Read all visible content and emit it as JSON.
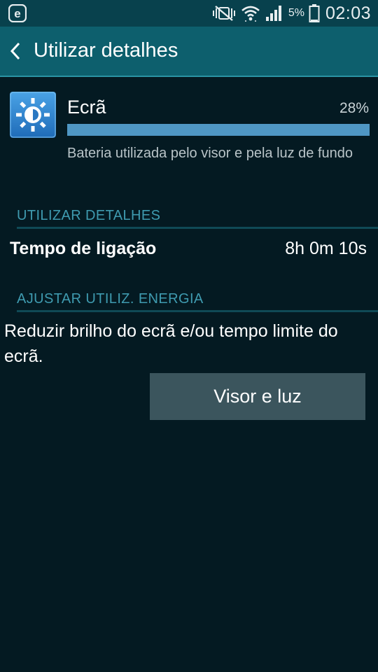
{
  "status_bar": {
    "app_icon": "e-browser-icon",
    "icons": [
      "mute-vibrate-icon",
      "wifi-icon",
      "signal-icon"
    ],
    "battery_percent": "5%",
    "battery_icon": "battery-icon",
    "time": "02:03"
  },
  "action_bar": {
    "back_icon": "chevron-left-icon",
    "title": "Utilizar detalhes",
    "color": "#0d5f6d"
  },
  "usage_item": {
    "icon": "brightness-icon",
    "name": "Ecrã",
    "percent_label": "28%",
    "percent_value": 28,
    "bar_color": "#4f97c4",
    "description": "Bateria utilizada pelo visor e pela luz de fundo"
  },
  "details_section": {
    "header": "UTILIZAR DETALHES",
    "rows": [
      {
        "label": "Tempo de ligação",
        "value": "8h 0m 10s"
      }
    ]
  },
  "energy_section": {
    "header": "AJUSTAR UTILIZ. ENERGIA",
    "text": "Reduzir brilho do ecrã e/ou tempo limite do ecrã.",
    "button_label": "Visor e luz"
  },
  "colors": {
    "background": "#041a22",
    "section_header": "#3f9bb0",
    "button": "#3b555d"
  }
}
